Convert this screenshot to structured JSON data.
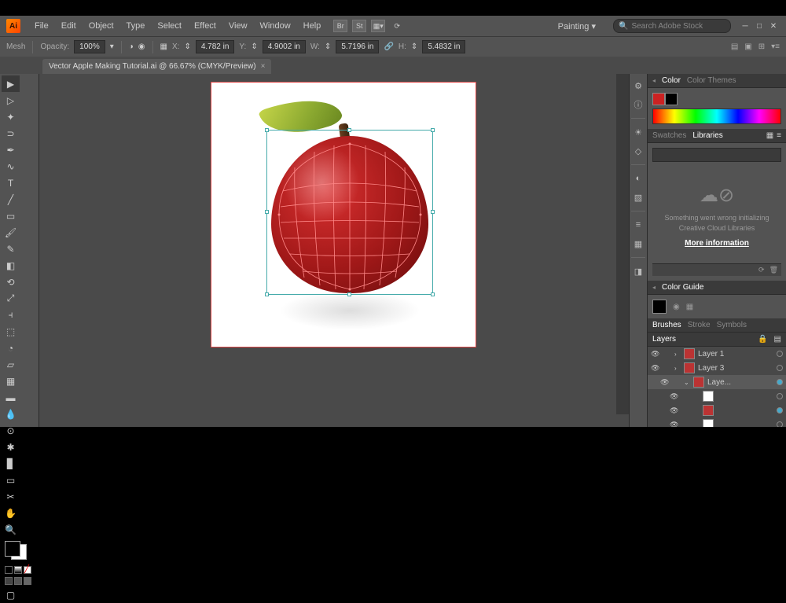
{
  "app": {
    "logo": "Ai"
  },
  "menu": [
    "File",
    "Edit",
    "Object",
    "Type",
    "Select",
    "Effect",
    "View",
    "Window",
    "Help"
  ],
  "workspace": "Painting",
  "search_placeholder": "Search Adobe Stock",
  "controlbar": {
    "tool": "Mesh",
    "opacity_label": "Opacity:",
    "opacity": "100%",
    "x_label": "X:",
    "x": "4.782 in",
    "y_label": "Y:",
    "y": "4.9002 in",
    "w_label": "W:",
    "w": "5.7196 in",
    "h_label": "H:",
    "h": "5.4832 in"
  },
  "tab": {
    "title": "Vector Apple Making Tutorial.ai @ 66.67% (CMYK/Preview)",
    "close": "×"
  },
  "panels": {
    "color": {
      "tabs": [
        "Color",
        "Color Themes"
      ]
    },
    "swatches": {
      "tabs": [
        "Swatches",
        "Libraries"
      ]
    },
    "libraries": {
      "error": "Something went wrong initializing Creative Cloud Libraries",
      "link": "More information"
    },
    "guide": {
      "tab": "Color Guide"
    },
    "brushes": {
      "tabs": [
        "Brushes",
        "Stroke",
        "Symbols"
      ]
    },
    "layers": {
      "tab": "Layers",
      "items": [
        {
          "name": "Layer 1",
          "thumb": "red"
        },
        {
          "name": "Layer 3",
          "thumb": "red"
        },
        {
          "name": "Laye...",
          "thumb": "red",
          "selected": true
        },
        {
          "name": "",
          "thumb": "white"
        },
        {
          "name": "",
          "thumb": "red"
        },
        {
          "name": "",
          "thumb": "white"
        }
      ]
    }
  }
}
